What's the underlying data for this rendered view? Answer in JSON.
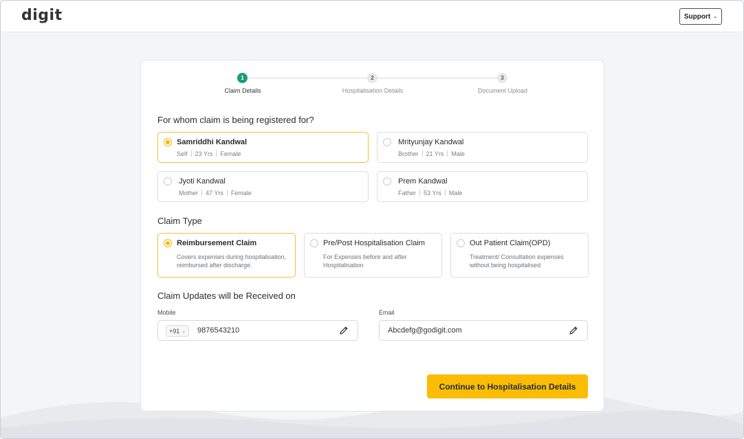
{
  "header": {
    "logo": "digit",
    "support_label": "Support"
  },
  "stepper": [
    {
      "number": "1",
      "label": "Claim Details",
      "active": true
    },
    {
      "number": "2",
      "label": "Hospitalisation Details",
      "active": false
    },
    {
      "number": "3",
      "label": "Document Upload",
      "active": false
    }
  ],
  "members_section": {
    "title": "For whom claim is being registered for?",
    "members": [
      {
        "name": "Samriddhi Kandwal",
        "relation": "Self",
        "age": "23 Yrs",
        "gender": "Female",
        "selected": true
      },
      {
        "name": "Mrityunjay Kandwal",
        "relation": "Brother",
        "age": "21 Yrs",
        "gender": "Male",
        "selected": false
      },
      {
        "name": "Jyoti Kandwal",
        "relation": "Mother",
        "age": "47 Yrs",
        "gender": "Female",
        "selected": false
      },
      {
        "name": "Prem Kandwal",
        "relation": "Father",
        "age": "53 Yrs",
        "gender": "Male",
        "selected": false
      }
    ]
  },
  "claim_type": {
    "title": "Claim Type",
    "options": [
      {
        "name": "Reimbursement Claim",
        "desc": "Covers expenses during hospitalisation, reimbursed after discharge.",
        "selected": true
      },
      {
        "name": "Pre/Post Hospitalisation Claim",
        "desc": "For Expenses before and after Hospitalisation",
        "selected": false
      },
      {
        "name": "Out Patient Claim(OPD)",
        "desc": "Treatment/ Consultation expenses without being hospitalised",
        "selected": false
      }
    ]
  },
  "updates": {
    "title": "Claim Updates will be Received on",
    "mobile_label": "Mobile",
    "country_code": "+91",
    "mobile_value": "9876543210",
    "email_label": "Email",
    "email_value": "Abcdefg@godigit.com"
  },
  "cta_label": "Continue to Hospitalisation Details",
  "colors": {
    "accent": "#fbbc05",
    "step_active": "#1a9c7c",
    "selected_border": "#f2c12e"
  }
}
